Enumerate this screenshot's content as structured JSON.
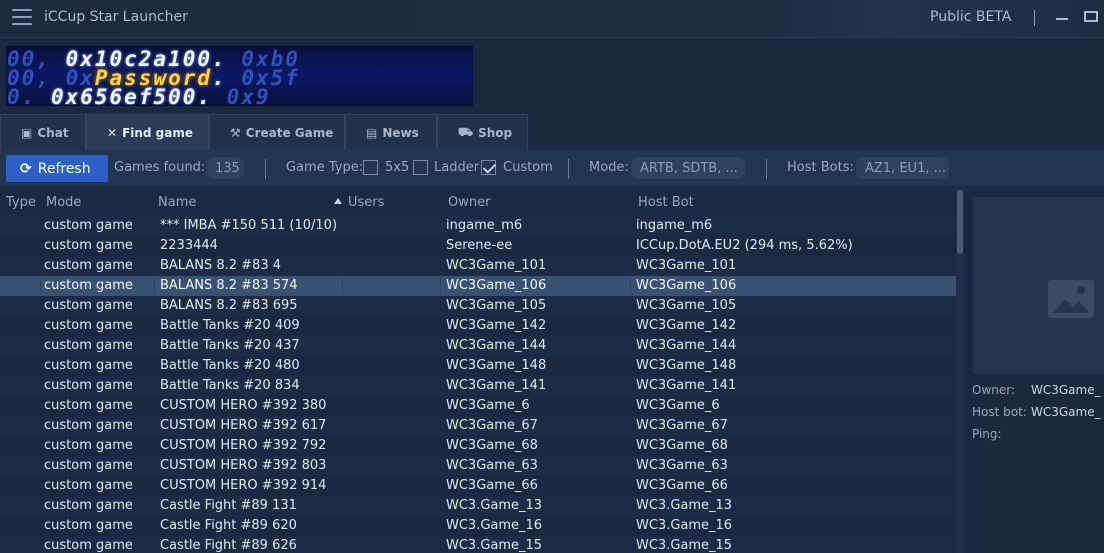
{
  "titlebar": {
    "title": "iCCup Star Launcher",
    "beta": "Public BETA",
    "sep": "|"
  },
  "banner": {
    "line1": [
      "00, ",
      "0x10c2a100",
      ". ",
      "0xb0"
    ],
    "line2": [
      "00, ",
      "0x",
      "Password",
      ". ",
      "0x5f"
    ],
    "line3": [
      "0. ",
      "0x656ef500",
      ". ",
      "0x9"
    ]
  },
  "tabs": [
    {
      "label": "Chat",
      "icon": "chat-icon",
      "glyph": "▣"
    },
    {
      "label": "Find game",
      "icon": "crossed-swords-icon",
      "glyph": "✕"
    },
    {
      "label": "Create Game",
      "icon": "hammer-icon",
      "glyph": "⚒"
    },
    {
      "label": "News",
      "icon": "newspaper-icon",
      "glyph": "▤"
    },
    {
      "label": "Shop",
      "icon": "cart-icon",
      "glyph": "⛟"
    }
  ],
  "toolbar": {
    "refresh_label": "Refresh",
    "games_found_label": "Games found:",
    "games_found_count": "135",
    "game_type_label": "Game Type:",
    "type_5x5": "5x5",
    "type_5x5_checked": false,
    "type_ladder": "Ladder",
    "type_ladder_checked": false,
    "type_custom": "Custom",
    "type_custom_checked": true,
    "mode_label": "Mode:",
    "mode_value": "ARTB, SDTB, ...",
    "host_bots_label": "Host Bots:",
    "host_bots_value": "AZ1, EU1, ..."
  },
  "table": {
    "columns": {
      "type": "Type",
      "mode": "Mode",
      "name": "Name",
      "users": "Users",
      "owner": "Owner",
      "host_bot": "Host Bot"
    },
    "selected_index": 3,
    "rows": [
      {
        "type": "",
        "mode": "custom game",
        "name": "*** IMBA #150 511 (10/10)",
        "users": "",
        "owner": "ingame_m6",
        "host_bot": "ingame_m6"
      },
      {
        "type": "",
        "mode": "custom game",
        "name": "2233444",
        "users": "",
        "owner": "Serene-ee",
        "host_bot": "ICCup.DotA.EU2 (294 ms, 5.62%)"
      },
      {
        "type": "",
        "mode": "custom game",
        "name": "BALANS 8.2 #83 4",
        "users": "",
        "owner": "WC3Game_101",
        "host_bot": "WC3Game_101"
      },
      {
        "type": "",
        "mode": "custom game",
        "name": "BALANS 8.2 #83 574",
        "users": "",
        "owner": "WC3Game_106",
        "host_bot": "WC3Game_106"
      },
      {
        "type": "",
        "mode": "custom game",
        "name": "BALANS 8.2 #83 695",
        "users": "",
        "owner": "WC3Game_105",
        "host_bot": "WC3Game_105"
      },
      {
        "type": "",
        "mode": "custom game",
        "name": "Battle Tanks #20 409",
        "users": "",
        "owner": "WC3Game_142",
        "host_bot": "WC3Game_142"
      },
      {
        "type": "",
        "mode": "custom game",
        "name": "Battle Tanks #20 437",
        "users": "",
        "owner": "WC3Game_144",
        "host_bot": "WC3Game_144"
      },
      {
        "type": "",
        "mode": "custom game",
        "name": "Battle Tanks #20 480",
        "users": "",
        "owner": "WC3Game_148",
        "host_bot": "WC3Game_148"
      },
      {
        "type": "",
        "mode": "custom game",
        "name": "Battle Tanks #20 834",
        "users": "",
        "owner": "WC3Game_141",
        "host_bot": "WC3Game_141"
      },
      {
        "type": "",
        "mode": "custom game",
        "name": "CUSTOM HERO #392 380",
        "users": "",
        "owner": "WC3Game_6",
        "host_bot": "WC3Game_6"
      },
      {
        "type": "",
        "mode": "custom game",
        "name": "CUSTOM HERO #392 617",
        "users": "",
        "owner": "WC3Game_67",
        "host_bot": "WC3Game_67"
      },
      {
        "type": "",
        "mode": "custom game",
        "name": "CUSTOM HERO #392 792",
        "users": "",
        "owner": "WC3Game_68",
        "host_bot": "WC3Game_68"
      },
      {
        "type": "",
        "mode": "custom game",
        "name": "CUSTOM HERO #392 803",
        "users": "",
        "owner": "WC3Game_63",
        "host_bot": "WC3Game_63"
      },
      {
        "type": "",
        "mode": "custom game",
        "name": "CUSTOM HERO #392 914",
        "users": "",
        "owner": "WC3Game_66",
        "host_bot": "WC3Game_66"
      },
      {
        "type": "",
        "mode": "custom game",
        "name": "Castle Fight #89 131",
        "users": "",
        "owner": "WC3.Game_13",
        "host_bot": "WC3.Game_13"
      },
      {
        "type": "",
        "mode": "custom game",
        "name": "Castle Fight #89 620",
        "users": "",
        "owner": "WC3.Game_16",
        "host_bot": "WC3.Game_16"
      },
      {
        "type": "",
        "mode": "custom game",
        "name": "Castle Fight #89 626",
        "users": "",
        "owner": "WC3.Game_15",
        "host_bot": "WC3.Game_15"
      }
    ]
  },
  "details": {
    "owner_label": "Owner:",
    "owner_value": "WC3Game_",
    "host_bot_label": "Host bot:",
    "host_bot_value": "WC3Game_",
    "ping_label": "Ping:",
    "ping_value": ""
  }
}
